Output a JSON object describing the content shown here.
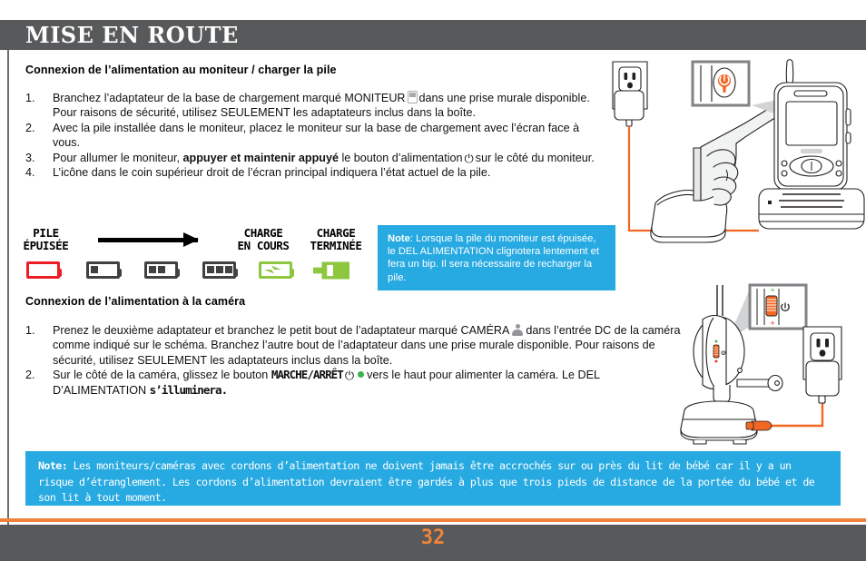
{
  "header": {
    "title": "MISE EN ROUTE"
  },
  "section1": {
    "title": "Connexion de l’alimentation au moniteur / charger la pile",
    "items": [
      {
        "num": "1.",
        "pre": "Branchez l’adaptateur de la base de chargement marqué MONITEUR",
        "post": "dans une prise murale disponible. Pour raisons de sécurité, utilisez SEULEMENT les adaptateurs inclus dans la boîte."
      },
      {
        "num": "2.",
        "text": "Avec la pile installée dans le moniteur, placez le moniteur sur la base de chargement avec l’écran face à vous."
      },
      {
        "num": "3.",
        "pre": "Pour allumer le moniteur,",
        "strong": "appuyer et maintenir appuyé",
        "mid": "le bouton d’alimentation",
        "post": "sur le côté du moniteur."
      },
      {
        "num": "4.",
        "text": "L’icône dans le coin supérieur droit de l’écran principal indiquera l’état actuel de la pile."
      }
    ]
  },
  "battery_diagram": {
    "label_empty": "PILE\nÉPUISÉE",
    "label_charging": "CHARGE\nEN COURS",
    "label_done": "CHARGE\nTERMINÉE",
    "states": [
      {
        "name": "empty",
        "bars": 0,
        "color": "#ed1c24"
      },
      {
        "name": "one-bar",
        "bars": 1,
        "color": "#414042"
      },
      {
        "name": "two-bar",
        "bars": 2,
        "color": "#414042"
      },
      {
        "name": "three-bar",
        "bars": 3,
        "color": "#414042"
      },
      {
        "name": "charging",
        "bars": 0,
        "color": "#8dc63f"
      },
      {
        "name": "charge-complete",
        "bars": 0,
        "color": "#8dc63f"
      }
    ]
  },
  "note_battery": {
    "label": "Note",
    "text": ": Lorsque la pile du moniteur est épuisée, le DEL ALIMENTATION clignotera lentement et fera un bip. Il sera nécessaire de recharger la pile."
  },
  "section2": {
    "title": "Connexion de l’alimentation à la caméra",
    "items": [
      {
        "num": "1.",
        "pre": "Prenez le deuxième adaptateur et branchez le petit bout de l’adaptateur marqué CAMÉRA",
        "post": "dans l’entrée DC de la caméra comme indiqué sur le schéma. Branchez l’autre bout de l’adaptateur dans une prise murale disponible. Pour raisons de sécurité, utilisez SEULEMENT les adaptateurs inclus dans la boîte."
      },
      {
        "num": "2.",
        "pre": "Sur le côté de la caméra, glissez le bouton",
        "strong": "MARCHE/ARRÊT",
        "mid": "vers le haut pour alimenter la caméra. Le DEL D’ALIMENTATION",
        "strong2": "s’illuminera."
      }
    ]
  },
  "note_bottom": {
    "label": "Note:",
    "text": "  Les moniteurs/caméras avec cordons d’alimentation ne doivent jamais être accrochés sur ou près du lit de bébé car il y a un risque d’étranglement. Les cordons d’alimentation devraient être gardés à plus que trois pieds de distance de la portée du bébé et de son lit à tout moment."
  },
  "footer": {
    "page_number": "32"
  },
  "colors": {
    "header_gray": "#58595b",
    "accent_orange": "#f0833a",
    "note_blue": "#27aae1",
    "battery_red": "#ed1c24",
    "battery_green": "#8dc63f",
    "battery_dark": "#414042",
    "icon_gray": "#939598"
  },
  "illustrations": {
    "monitor_setup": "monitor-charging-illustration",
    "camera_setup": "camera-power-illustration",
    "callout_power_button": "power-button-callout",
    "callout_camera_switch": "camera-switch-callout"
  }
}
